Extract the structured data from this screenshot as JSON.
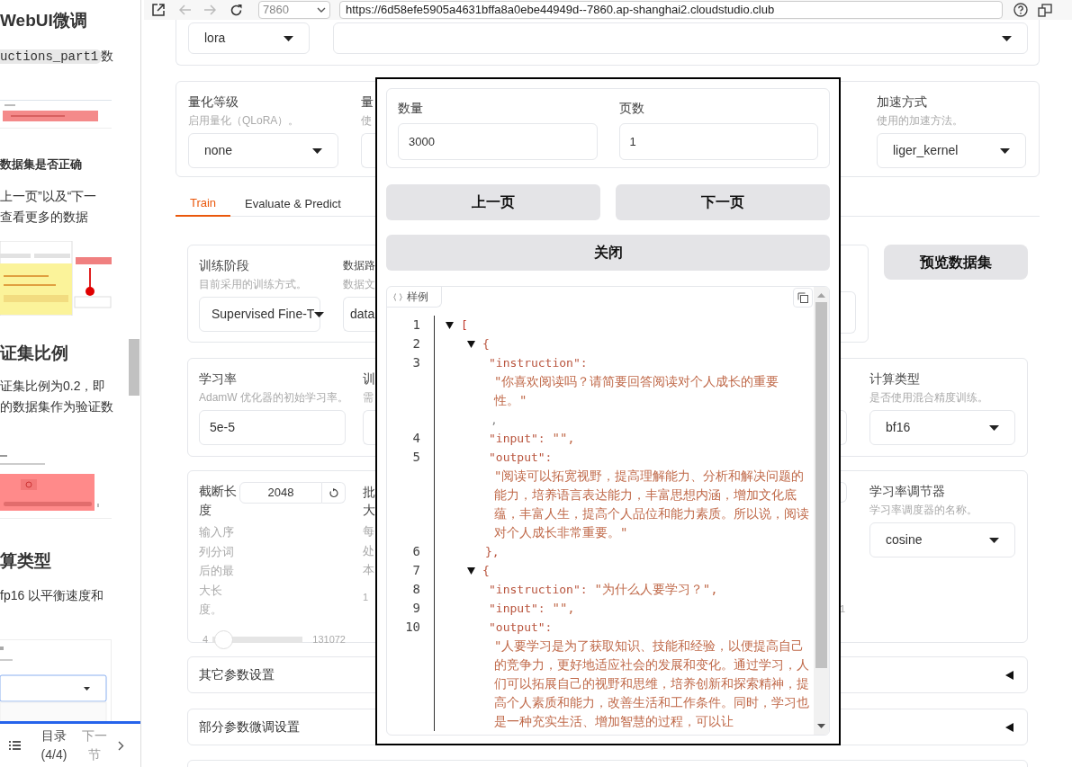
{
  "browser": {
    "port": "7860",
    "url": "https://6d58efe5905a4631bffa8a0ebe44949d--7860.ap-shanghai2.cloudstudio.club"
  },
  "doc_panel": {
    "blocks": [
      {
        "kind": "heading",
        "text": "WebUI微调"
      },
      {
        "kind": "code_text",
        "code": "uctions_part1",
        "text": "数"
      },
      {
        "kind": "picture"
      },
      {
        "kind": "bold",
        "text": "数据集是否正确"
      },
      {
        "kind": "paragraph",
        "lines": [
          "上一页”以及“下一",
          "查看更多的数据"
        ]
      },
      {
        "kind": "picture"
      },
      {
        "kind": "heading",
        "text": "证集比例"
      },
      {
        "kind": "paragraph",
        "lines": [
          "证集比例为0.2，即",
          "的数据集作为验证数"
        ]
      },
      {
        "kind": "picture"
      },
      {
        "kind": "heading",
        "text": "算类型"
      },
      {
        "kind": "paragraph",
        "lines": [
          "fp16 以平衡速度和"
        ]
      },
      {
        "kind": "picture"
      }
    ],
    "nav": {
      "toc": "目录 (4/4)",
      "next": "下一节"
    }
  },
  "model_row": {
    "method": "lora"
  },
  "quant_card": {
    "columns": [
      {
        "kind": "dropdown",
        "label": "量化等级",
        "description": "启用量化（QLoRA）。",
        "value": "none"
      },
      {
        "kind": "partial",
        "label": "量",
        "description": "使"
      },
      {
        "kind": "dropdown",
        "label": "加速方式",
        "description": "使用的加速方法。",
        "value": "liger_kernel"
      }
    ]
  },
  "tabs": [
    {
      "label": "Train",
      "selected": true
    },
    {
      "label": "Evaluate & Predict",
      "selected": false
    }
  ],
  "stage_card": {
    "columns": [
      {
        "kind": "dropdown",
        "label": "训练阶段",
        "description": "目前采用的训练方式。",
        "value": "Supervised Fine-T"
      },
      {
        "kind": "partial",
        "label": "数据路",
        "description": "数据文",
        "value": "data"
      }
    ]
  },
  "preview_button": "预览数据集",
  "lr_card": {
    "columns": [
      {
        "kind": "input",
        "label": "学习率",
        "description": "AdamW 优化器的初始学习率。",
        "value": "5e-5"
      },
      {
        "kind": "partial",
        "label": "训",
        "description": "需"
      },
      {
        "kind": "dropdown",
        "label": "计算类型",
        "description": "是否使用混合精度训练。",
        "value": "bf16"
      }
    ]
  },
  "cutoff_card": {
    "columns": [
      {
        "kind": "slider",
        "label": "截断长度",
        "description": "输入序列分词后的最大长度。",
        "value": "2048",
        "min": "4",
        "max": "131072",
        "level": 0.016
      },
      {
        "kind": "partial_stack",
        "label": "批大",
        "description": "每处本",
        "value": "1"
      },
      {
        "kind": "partial_edge",
        "value": "1"
      },
      {
        "kind": "dropdown",
        "label": "学习率调节器",
        "description": "学习率调度器的名称。",
        "value": "cosine"
      }
    ]
  },
  "accordions": [
    {
      "label": "其它参数设置",
      "expanded": false
    },
    {
      "label": "部分参数微调设置",
      "expanded": false
    }
  ],
  "modal": {
    "fields": [
      {
        "label": "数量",
        "value": "3000"
      },
      {
        "label": "页数",
        "value": "1"
      }
    ],
    "page_buttons": [
      "上一页",
      "下一页"
    ],
    "close_button": "关闭",
    "code_block": {
      "label": "样例",
      "lines": [
        {
          "number": "1",
          "kind": "array_open",
          "text": "[",
          "expanded": true
        },
        {
          "number": "2",
          "kind": "object_open",
          "text": "{",
          "expanded": true
        },
        {
          "number": "3",
          "kind": "field_long",
          "key": "\"instruction\":",
          "value": "\"你喜欢阅读吗？请简要回答阅读对个人成长的重要性。\"",
          "trailing": ","
        },
        {
          "number": "4",
          "kind": "field",
          "key": "\"input\":",
          "value": "\"\","
        },
        {
          "number": "5",
          "kind": "field_long",
          "key": "\"output\":",
          "value": "\"阅读可以拓宽视野，提高理解能力、分析和解决问题的能力，培养语言表达能力，丰富思想内涵，增加文化底蕴，丰富人生，提高个人品位和能力素质。所以说，阅读对个人成长非常重要。\""
        },
        {
          "number": "6",
          "kind": "close",
          "text": "},"
        },
        {
          "number": "7",
          "kind": "object_open",
          "text": "{",
          "expanded": true
        },
        {
          "number": "8",
          "kind": "field",
          "key": "\"instruction\":",
          "value": "\"为什么人要学习？\","
        },
        {
          "number": "9",
          "kind": "field",
          "key": "\"input\":",
          "value": "\"\","
        },
        {
          "number": "10",
          "kind": "field_long",
          "key": "\"output\":",
          "value": "\"人要学习是为了获取知识、技能和经验，以便提高自己的竞争力，更好地适应社会的发展和变化。通过学习，人们可以拓展自己的视野和思维，培养创新和探索精神，提高个人素质和能力，改善生活和工作条件。同时，学习也是一种充实生活、增加智慧的过程，可以让"
        }
      ]
    }
  }
}
